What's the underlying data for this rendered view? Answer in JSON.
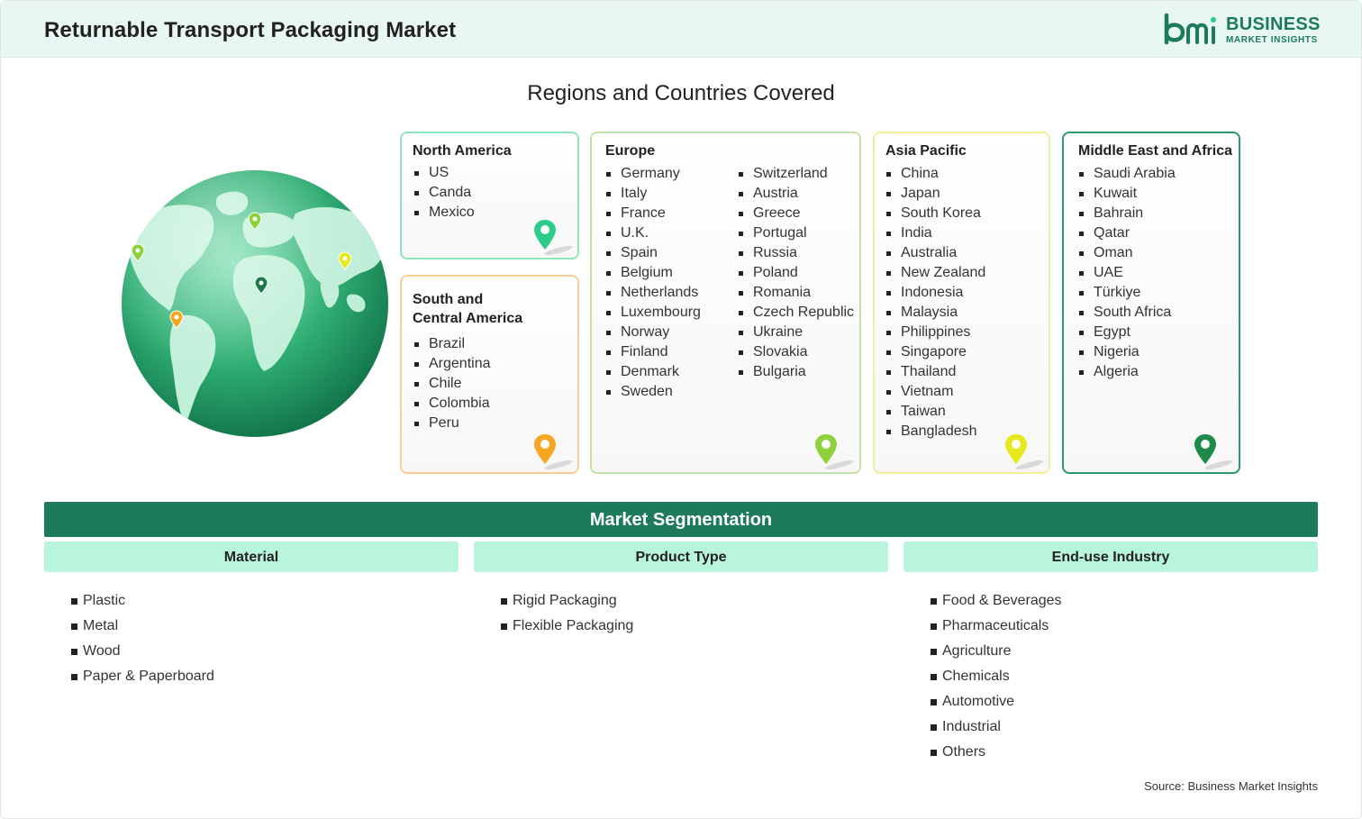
{
  "header": {
    "title": "Returnable Transport Packaging Market",
    "logo_line1": "BUSINESS",
    "logo_line2": "MARKET INSIGHTS",
    "logo_mark": "bmi"
  },
  "regions": {
    "title": "Regions and Countries Covered",
    "north_america": {
      "title": "North America",
      "countries": [
        "US",
        "Canda",
        "Mexico"
      ],
      "pin_color": "#2ecc8a"
    },
    "south_central_america": {
      "title_line1": "South and",
      "title_line2": "Central America",
      "countries": [
        "Brazil",
        "Argentina",
        "Chile",
        "Colombia",
        "Peru"
      ],
      "pin_color": "#f5a623"
    },
    "europe": {
      "title": "Europe",
      "col1": [
        "Germany",
        "Italy",
        "France",
        "U.K.",
        "Spain",
        "Belgium",
        "Netherlands",
        "Luxembourg",
        "Norway",
        "Finland",
        "Denmark",
        "Sweden"
      ],
      "col2": [
        "Switzerland",
        "Austria",
        "Greece",
        "Portugal",
        "Russia",
        "Poland",
        "Romania",
        "Czech Republic",
        "Ukraine",
        "Slovakia",
        "Bulgaria"
      ],
      "pin_color": "#8ed13a"
    },
    "asia_pacific": {
      "title": "Asia Pacific",
      "countries": [
        "China",
        "Japan",
        "South Korea",
        "India",
        "Australia",
        "New Zealand",
        "Indonesia",
        "Malaysia",
        "Philippines",
        "Singapore",
        "Thailand",
        "Vietnam",
        "Taiwan",
        "Bangladesh"
      ],
      "pin_color": "#e8e81e"
    },
    "middle_east_africa": {
      "title": "Middle East and Africa",
      "countries": [
        "Saudi Arabia",
        "Kuwait",
        "Bahrain",
        "Qatar",
        "Oman",
        "UAE",
        "Türkiye",
        "South Africa",
        "Egypt",
        "Nigeria",
        "Algeria"
      ],
      "pin_color": "#1e8a4a"
    }
  },
  "segmentation": {
    "title": "Market Segmentation",
    "material": {
      "title": "Material",
      "items": [
        "Plastic",
        "Metal",
        "Wood",
        "Paper & Paperboard"
      ]
    },
    "product_type": {
      "title": "Product Type",
      "items": [
        "Rigid Packaging",
        "Flexible Packaging"
      ]
    },
    "end_use": {
      "title": "End-use Industry",
      "items": [
        "Food & Beverages",
        "Pharmaceuticals",
        "Agriculture",
        "Chemicals",
        "Automotive",
        "Industrial",
        "Others"
      ]
    }
  },
  "source": "Source: Business Market Insights",
  "colors": {
    "brand_green": "#1e7a5c",
    "header_bg": "#e8f7ef",
    "segment_header_bg": "#b8f5dc",
    "north_america_border": "#8ee6bd",
    "south_america_border": "#f7cf97",
    "europe_border": "#bfe3a8",
    "asia_border": "#f2f0a0",
    "mea_border": "#2a9a6a"
  }
}
